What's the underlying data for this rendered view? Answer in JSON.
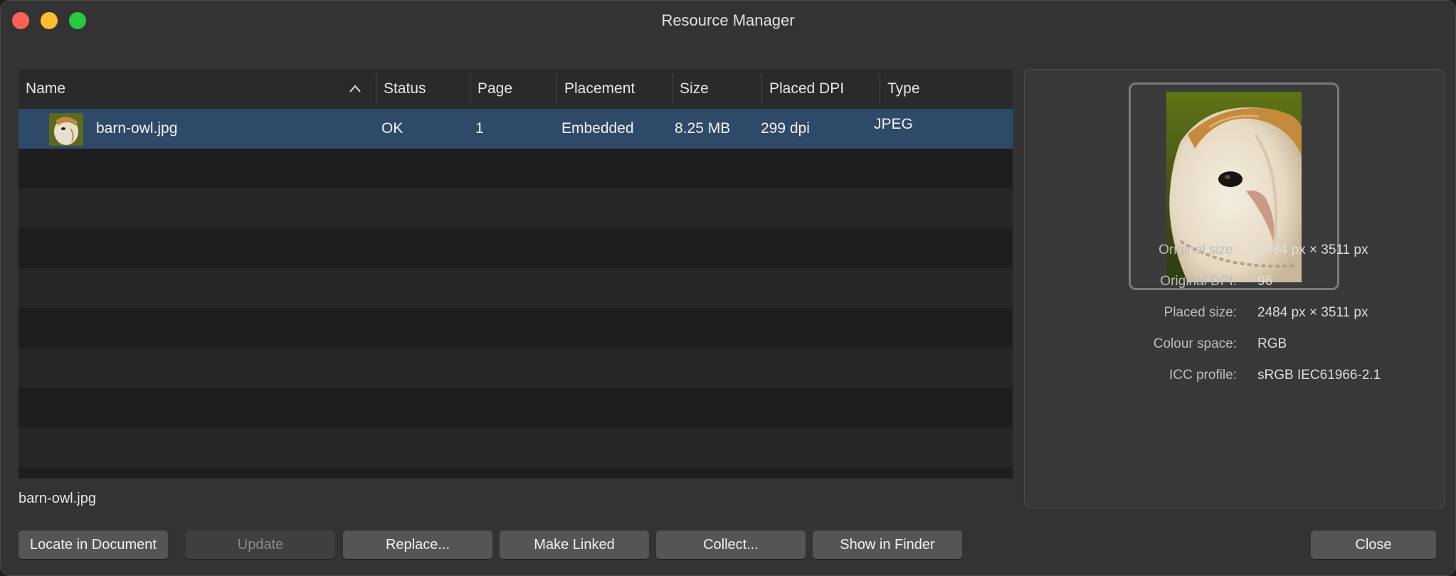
{
  "window": {
    "title": "Resource Manager"
  },
  "table": {
    "columns": [
      {
        "label": "Name"
      },
      {
        "label": "Status"
      },
      {
        "label": "Page"
      },
      {
        "label": "Placement"
      },
      {
        "label": "Size"
      },
      {
        "label": "Placed DPI"
      },
      {
        "label": "Type"
      }
    ],
    "sort": {
      "column": "Name",
      "direction": "ascending",
      "icon": "chevron-up-icon"
    },
    "rows": [
      {
        "thumbnail_icon": "barn-owl-thumbnail",
        "name": "barn-owl.jpg",
        "status": "OK",
        "page": "1",
        "placement": "Embedded",
        "size": "8.25 MB",
        "placed_dpi": "299 dpi",
        "type": "JPEG",
        "selected": true
      }
    ]
  },
  "selection_label": "barn-owl.jpg",
  "info": {
    "original_size": {
      "label": "Original size:",
      "value": "2484 px × 3511 px"
    },
    "original_dpi": {
      "label": "Original DPI:",
      "value": "96"
    },
    "placed_size": {
      "label": "Placed size:",
      "value": "2484 px × 3511 px"
    },
    "colour_space": {
      "label": "Colour space:",
      "value": "RGB"
    },
    "icc_profile": {
      "label": "ICC profile:",
      "value": "sRGB IEC61966-2.1"
    }
  },
  "buttons": {
    "locate": "Locate in Document",
    "update": "Update",
    "replace": "Replace...",
    "make_linked": "Make Linked",
    "collect": "Collect...",
    "show_in_finder": "Show in Finder",
    "close": "Close"
  },
  "colors": {
    "selection": "#2f4a68",
    "close_button": "#fe5f57",
    "minimize_button": "#febc2e",
    "maximize_button": "#28c840"
  }
}
